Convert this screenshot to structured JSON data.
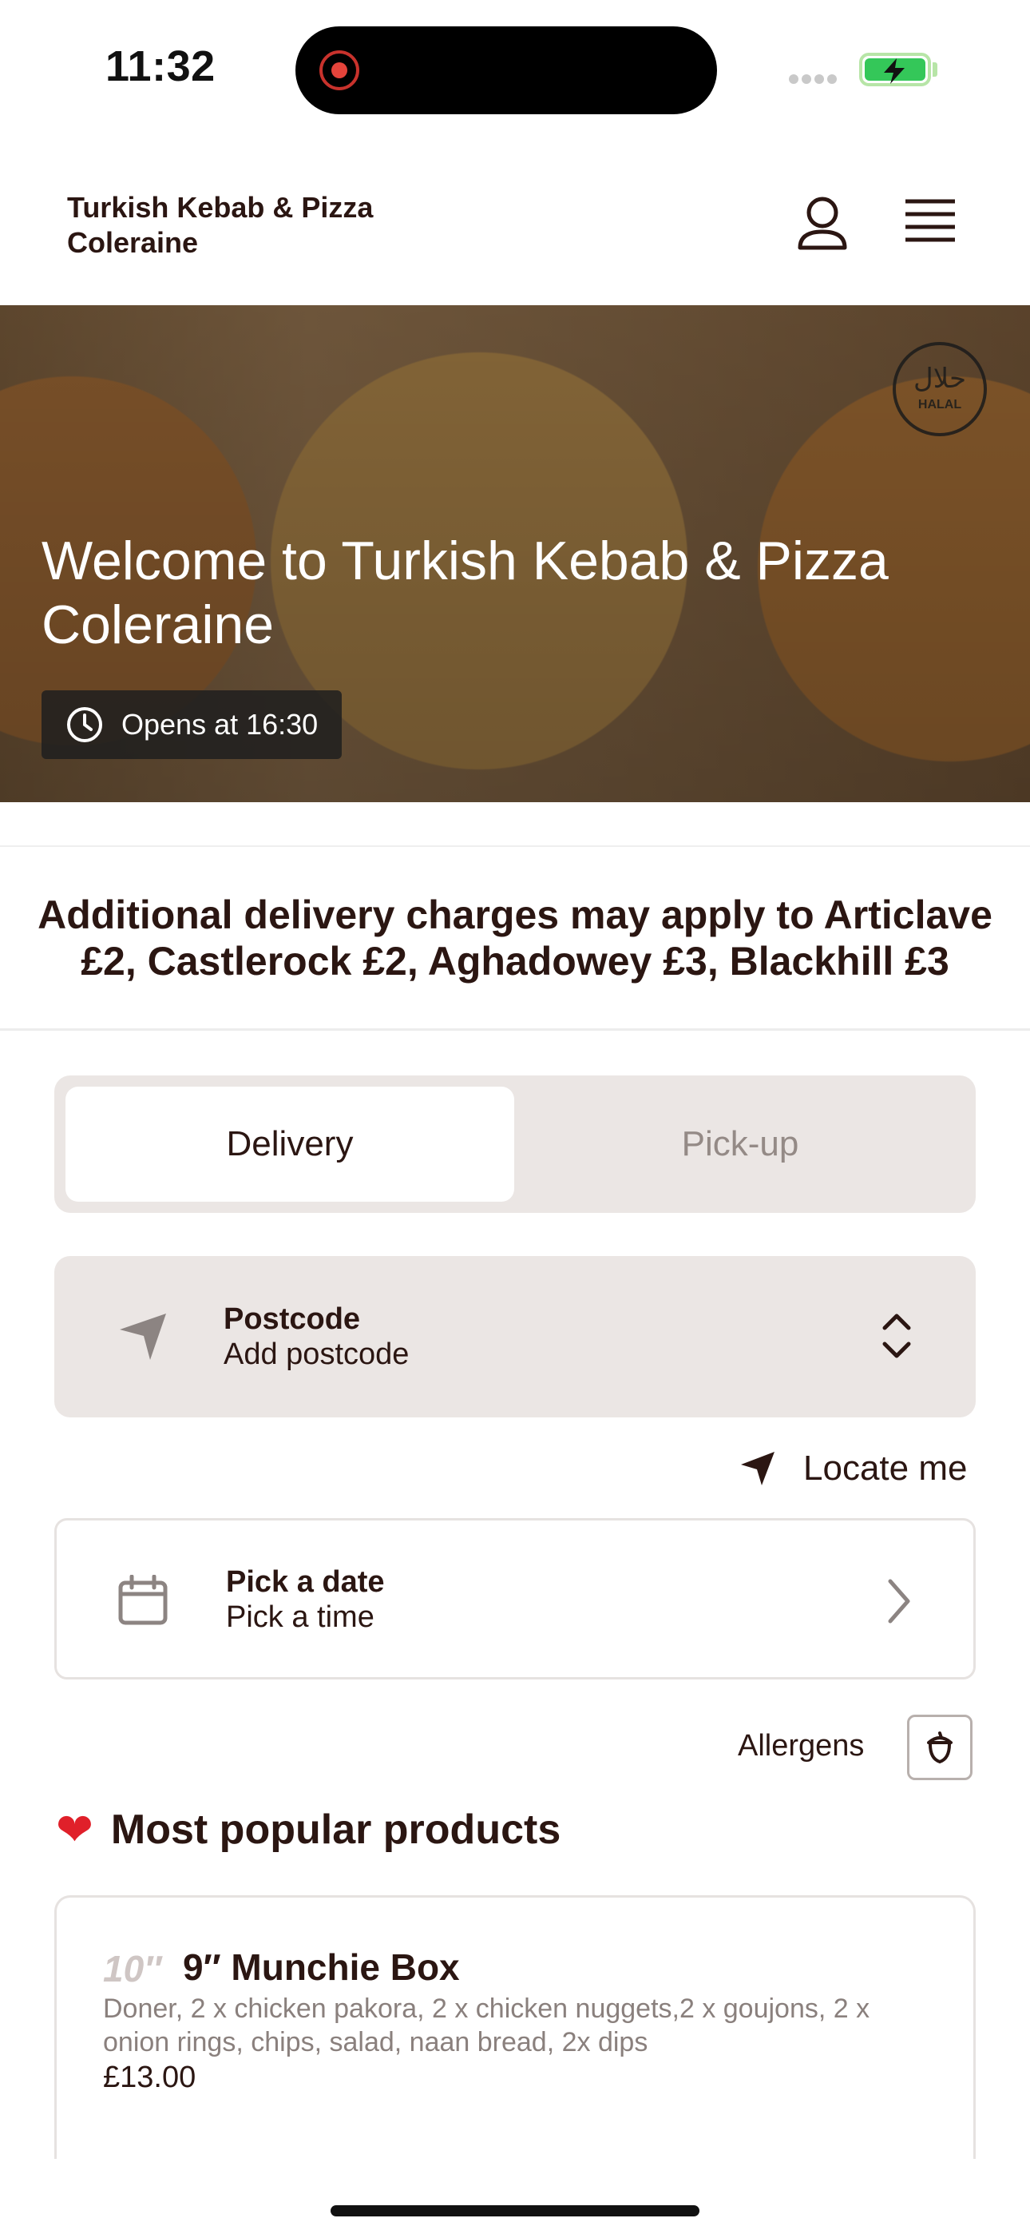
{
  "status_bar": {
    "time": "11:32"
  },
  "header": {
    "title": "Turkish Kebab & Pizza Coleraine"
  },
  "hero": {
    "badge_text": "حلال",
    "badge_subtext": "HALAL",
    "title": "Welcome to Turkish Kebab & Pizza Coleraine",
    "opening_text": "Opens at 16:30"
  },
  "notice": {
    "text": "Additional delivery charges may apply to Articlave £2, Castlerock £2, Aghadowey £3, Blackhill £3"
  },
  "order_tabs": {
    "delivery_label": "Delivery",
    "pickup_label": "Pick-up",
    "selected": "Delivery"
  },
  "postcode": {
    "label": "Postcode",
    "value": "Add postcode"
  },
  "locate": {
    "label": "Locate me"
  },
  "schedule": {
    "date_label": "Pick a date",
    "time_label": "Pick a time"
  },
  "allergens": {
    "label": "Allergens"
  },
  "popular": {
    "title": "Most popular products",
    "products": [
      {
        "size": "10″",
        "name": "9″ Munchie Box",
        "description": "Doner, 2 x chicken pakora, 2 x chicken nuggets,2 x goujons, 2 x onion rings, chips, salad, naan bread, 2x dips",
        "price": "£13.00"
      }
    ]
  },
  "colors": {
    "text": "#2b1612",
    "panel": "#ebe6e4",
    "heart": "#e0202a"
  }
}
